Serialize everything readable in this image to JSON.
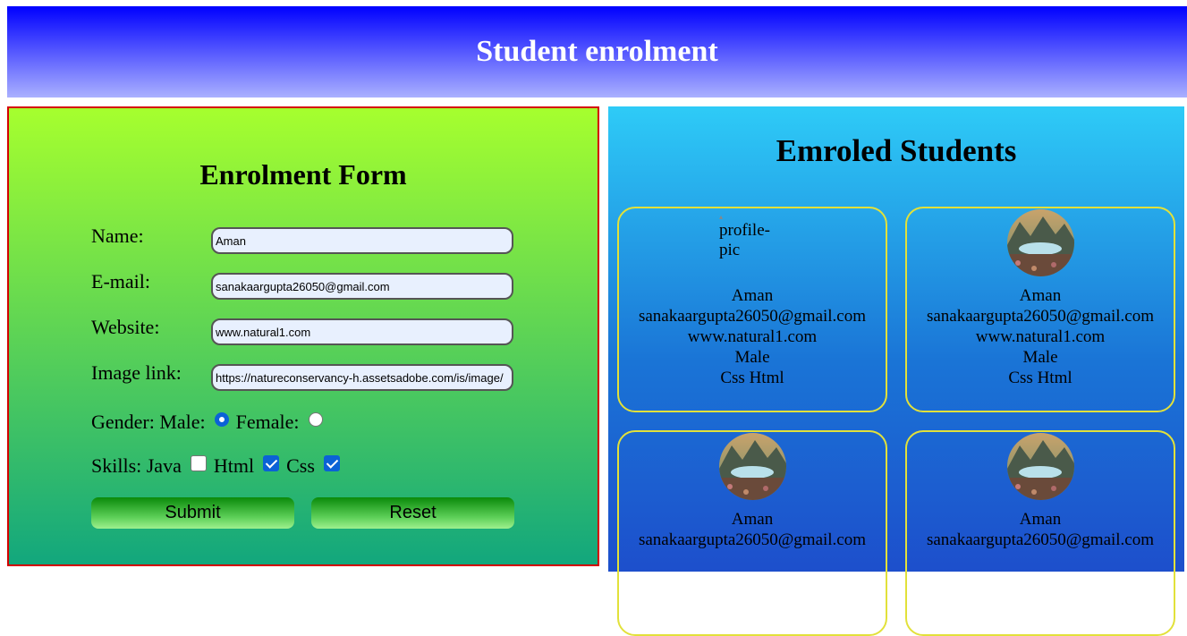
{
  "header": {
    "title": "Student enrolment"
  },
  "form": {
    "title": "Enrolment Form",
    "name_label": "Name:",
    "name_value": "Aman",
    "email_label": "E-mail:",
    "email_value": "sanakaargupta26050@gmail.com",
    "website_label": "Website:",
    "website_value": "www.natural1.com",
    "image_label": "Image link:",
    "image_value": "https://natureconservancy-h.assetsadobe.com/is/image/",
    "gender_label": "Gender: Male:",
    "female_label": "Female:",
    "gender_selected": "Male",
    "skills_label": "Skills: Java",
    "html_label": "Html",
    "css_label": "Css",
    "skills_checked": {
      "java": false,
      "html": true,
      "css": true
    },
    "submit_label": "Submit",
    "reset_label": "Reset"
  },
  "list": {
    "title": "Emroled Students",
    "students": [
      {
        "name": "Aman",
        "email": "sanakaargupta26050@gmail.com",
        "website": "www.natural1.com",
        "gender": "Male",
        "skills": "Css Html",
        "image_alt": "profile-pic"
      },
      {
        "name": "Aman",
        "email": "sanakaargupta26050@gmail.com",
        "website": "www.natural1.com",
        "gender": "Male",
        "skills": "Css Html"
      },
      {
        "name": "Aman",
        "email": "sanakaargupta26050@gmail.com"
      },
      {
        "name": "Aman",
        "email": "sanakaargupta26050@gmail.com"
      }
    ]
  }
}
